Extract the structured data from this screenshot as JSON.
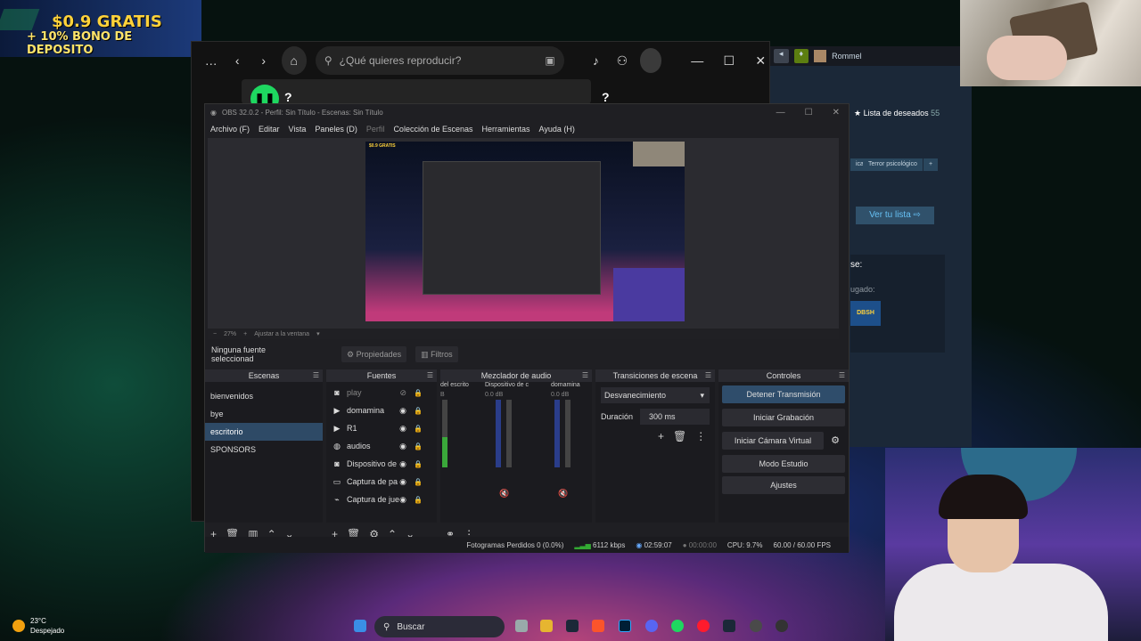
{
  "ad": {
    "line1": "$0.9 GRATIS",
    "line2": "+ 10% BONO DE DEPOSITO"
  },
  "spotify": {
    "search_placeholder": "¿Qué quieres reproducir?",
    "panel_marker": "?",
    "menu_icon": "…",
    "icons": [
      "back-icon",
      "forward-icon",
      "home-icon",
      "search-icon",
      "browse-icon",
      "bell-icon",
      "friends-icon",
      "avatar",
      "minimize-icon",
      "maximize-icon",
      "close-icon"
    ],
    "window_controls": {
      "minimize": "—",
      "maximize": "☐",
      "close": "✕"
    }
  },
  "steam": {
    "user": "Rommel",
    "wishlist": "Lista de deseados",
    "wishlist_count": "55",
    "tags": [
      "ica",
      "Terror psicológico",
      "+"
    ],
    "view_list": "Ver tu lista",
    "label_se": "se:",
    "label_jugado": "ugado:",
    "game_badge": "DBSH"
  },
  "obs": {
    "title": "OBS 32.0.2 - Perfil: Sin Título - Escenas: Sin Título",
    "menu": [
      "Archivo (F)",
      "Editar",
      "Vista",
      "Paneles (D)",
      "Perfil",
      "Colección de Escenas",
      "Herramientas",
      "Ayuda (H)"
    ],
    "zoom": "27%",
    "zoom_fit": "Ajustar a la ventana",
    "no_source": "Ninguna fuente seleccionad",
    "properties": "Propiedades",
    "filters": "Filtros",
    "docks": {
      "scenes": "Escenas",
      "sources": "Fuentes",
      "mixer": "Mezclador de audio",
      "transitions": "Transiciones de escena",
      "controls": "Controles"
    },
    "scenes": [
      "bienvenidos",
      "bye",
      "escritorio",
      "SPONSORS"
    ],
    "selected_scene": "escritorio",
    "sources": [
      {
        "name": "play",
        "icon": "camera-icon",
        "visible": false
      },
      {
        "name": "domamina",
        "icon": "play-icon",
        "visible": true
      },
      {
        "name": "R1",
        "icon": "play-icon",
        "visible": true
      },
      {
        "name": "audios",
        "icon": "globe-icon",
        "visible": true
      },
      {
        "name": "Dispositivo de",
        "icon": "camera-icon",
        "visible": true
      },
      {
        "name": "Captura de pa",
        "icon": "monitor-icon",
        "visible": true
      },
      {
        "name": "Captura de jue",
        "icon": "gamepad-icon",
        "visible": true
      }
    ],
    "mixer_channels": [
      {
        "name": "del escrito",
        "db": "B",
        "level": 0.45
      },
      {
        "name": "Dispositivo de c",
        "db": "0.0 dB",
        "level": 0.0
      },
      {
        "name": "domamina",
        "db": "0.0 dB",
        "level": 0.0
      }
    ],
    "transition": {
      "type": "Desvanecimiento",
      "duration_label": "Duración",
      "duration": "300 ms"
    },
    "controls": [
      "Detener Transmisión",
      "Iniciar Grabación",
      "Iniciar Cámara Virtual",
      "Modo Estudio",
      "Ajustes"
    ],
    "status": {
      "dropped": "Fotogramas Perdidos 0 (0.0%)",
      "bitrate": "6112 kbps",
      "stream_time": "02:59:07",
      "rec_time": "00:00:00",
      "cpu": "CPU: 9.7%",
      "fps": "60.00 / 60.00 FPS"
    }
  },
  "taskbar": {
    "temp": "23°C",
    "weather": "Despejado",
    "search": "Buscar",
    "apps": [
      "windows-icon",
      "search-icon",
      "file-explorer-icon",
      "folder-icon",
      "steam-icon",
      "brave-icon",
      "photoshop-icon",
      "discord-icon",
      "spotify-icon",
      "opera-icon",
      "steam-icon",
      "chrome-icon",
      "obs-icon"
    ]
  }
}
